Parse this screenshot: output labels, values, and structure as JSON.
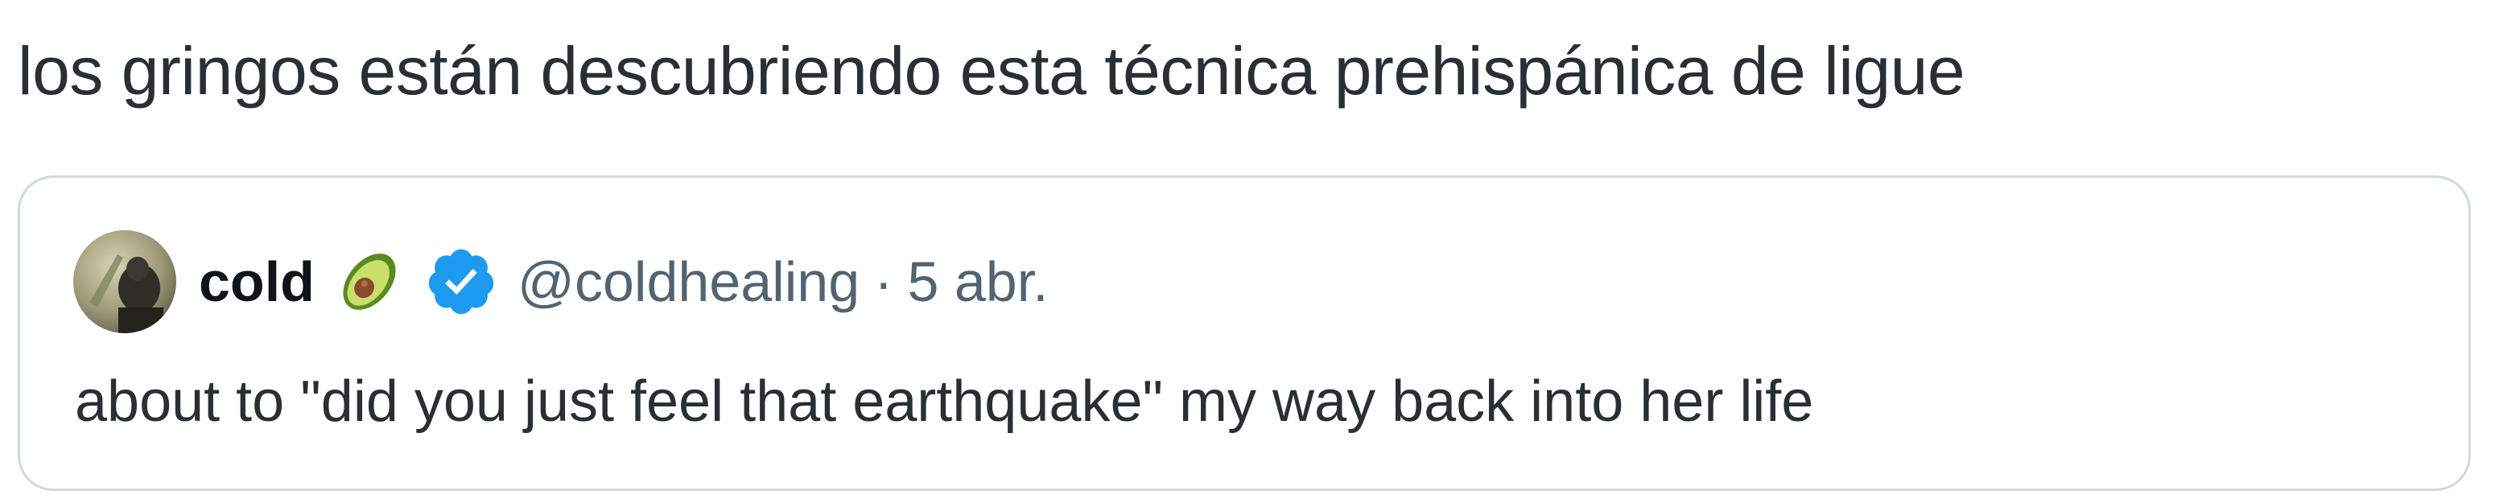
{
  "tweet": {
    "text": "los gringos están descubriendo esta técnica prehispánica de ligue"
  },
  "quoted_tweet": {
    "author": {
      "name": "cold",
      "emoji_icon": "avocado-emoji",
      "verified_icon": "verified-badge-icon",
      "handle": "@coldhealing"
    },
    "separator": "·",
    "date": "5 abr.",
    "text": "about to \"did you just feel that earthquake\" my way back into her life"
  },
  "colors": {
    "primary_text": "#0f1419",
    "secondary_text": "#536471",
    "border": "#cfd9de",
    "verified_blue": "#1d9bf0"
  }
}
